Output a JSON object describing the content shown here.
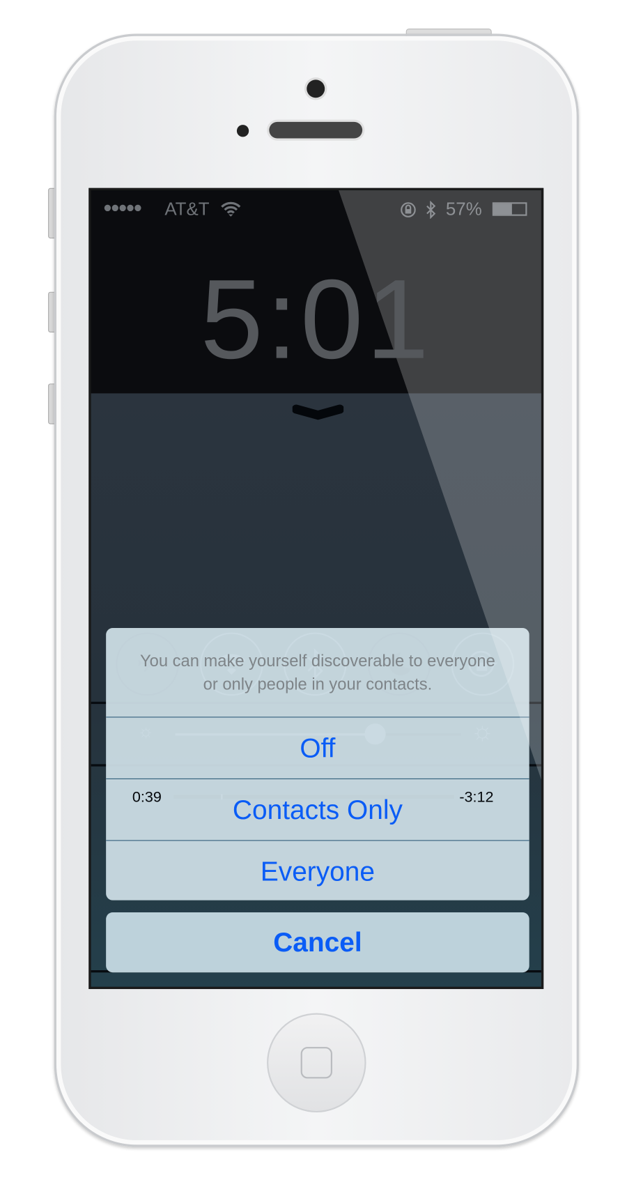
{
  "status_bar": {
    "signal_dots": "●●●●●",
    "carrier": "AT&T",
    "battery_percent": "57%",
    "battery_level": 0.57,
    "icons": [
      "wifi-icon",
      "rotation-lock-icon",
      "bluetooth-icon",
      "battery-icon"
    ]
  },
  "lock_screen": {
    "time": "5:01"
  },
  "control_center": {
    "toggles": [
      {
        "name": "airplane-mode",
        "icon": "✈",
        "state": "off"
      },
      {
        "name": "wifi",
        "icon": "wifi-icon",
        "state": "on"
      },
      {
        "name": "bluetooth",
        "icon": "bluetooth-icon",
        "state": "on"
      },
      {
        "name": "do-not-disturb",
        "icon": "☾",
        "state": "off"
      },
      {
        "name": "rotation-lock",
        "icon": "rotation-lock-icon",
        "state": "on"
      }
    ],
    "brightness_level": 0.7,
    "media": {
      "elapsed": "0:39",
      "remaining": "-3:12",
      "progress": 0.17
    }
  },
  "action_sheet": {
    "message": "You can make yourself discoverable to everyone or only people in your contacts.",
    "options": [
      "Off",
      "Contacts Only",
      "Everyone"
    ],
    "cancel": "Cancel",
    "accent": "#0a5cf6"
  }
}
